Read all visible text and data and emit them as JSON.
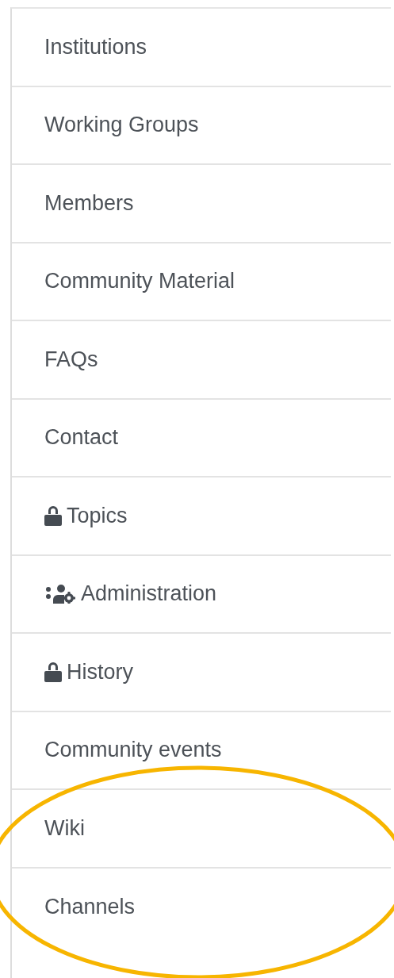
{
  "menu": {
    "items": [
      {
        "label": "Institutions"
      },
      {
        "label": "Working Groups"
      },
      {
        "label": "Members"
      },
      {
        "label": "Community Material"
      },
      {
        "label": "FAQs"
      },
      {
        "label": "Contact"
      },
      {
        "label": "Topics",
        "kind": "locked"
      },
      {
        "label": "Administration",
        "kind": "admin"
      },
      {
        "label": "History",
        "kind": "locked"
      },
      {
        "label": "Community events"
      },
      {
        "label": "Wiki"
      },
      {
        "label": "Channels"
      }
    ]
  },
  "annotation": {
    "kind": "ellipse",
    "color": "#f7b500"
  }
}
